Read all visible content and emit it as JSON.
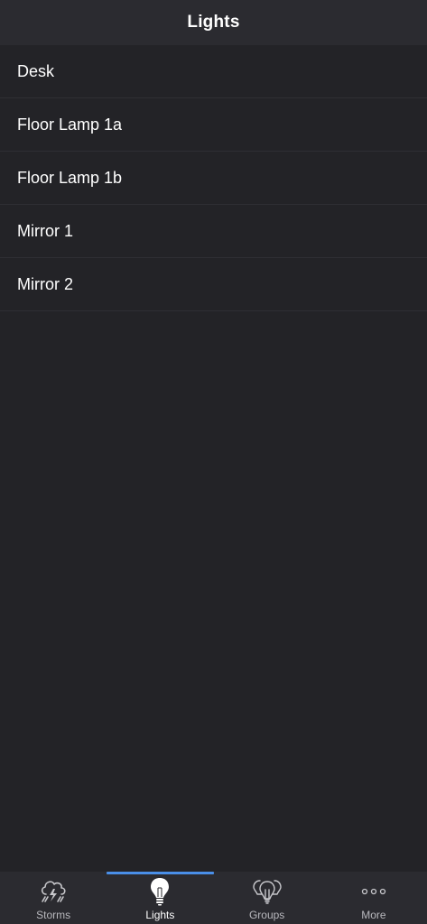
{
  "header": {
    "title": "Lights"
  },
  "lights": {
    "items": [
      {
        "label": "Desk"
      },
      {
        "label": "Floor Lamp 1a"
      },
      {
        "label": "Floor Lamp 1b"
      },
      {
        "label": "Mirror 1"
      },
      {
        "label": "Mirror 2"
      }
    ]
  },
  "tabbar": {
    "accent_color": "#4a8fe8",
    "tabs": [
      {
        "label": "Storms",
        "icon": "storm-cloud-icon",
        "active": false
      },
      {
        "label": "Lights",
        "icon": "lightbulb-icon",
        "active": true
      },
      {
        "label": "Groups",
        "icon": "lightbulb-group-icon",
        "active": false
      },
      {
        "label": "More",
        "icon": "more-dots-icon",
        "active": false
      }
    ]
  }
}
